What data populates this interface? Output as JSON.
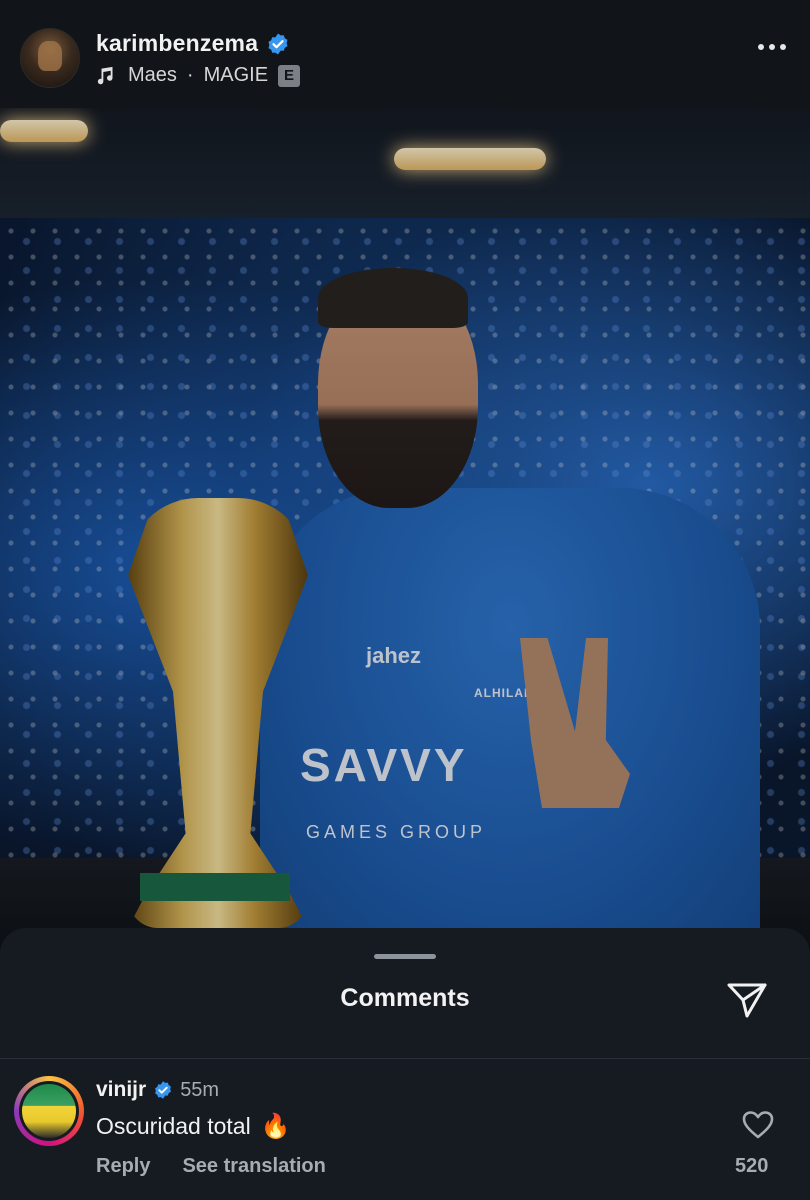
{
  "post": {
    "username": "karimbenzema",
    "verified": true,
    "music": {
      "artist": "Maes",
      "separator": "·",
      "track": "MAGIE",
      "explicit_badge": "E"
    }
  },
  "photo": {
    "shirt_sponsor": "SAVVY",
    "shirt_sponsor_sub": "GAMES GROUP",
    "shirt_brand": "jahez",
    "club": "ALHILAL"
  },
  "comments_sheet": {
    "title": "Comments",
    "comments": [
      {
        "username": "vinijr",
        "verified": true,
        "time": "55m",
        "text": "Oscuridad total",
        "emoji": "🔥",
        "reply_label": "Reply",
        "translate_label": "See translation",
        "like_count": "520"
      }
    ]
  },
  "colors": {
    "background": "#0d1117",
    "sheet": "#161b22",
    "verified_blue": "#3797f0",
    "muted_text": "#a7acb3"
  }
}
